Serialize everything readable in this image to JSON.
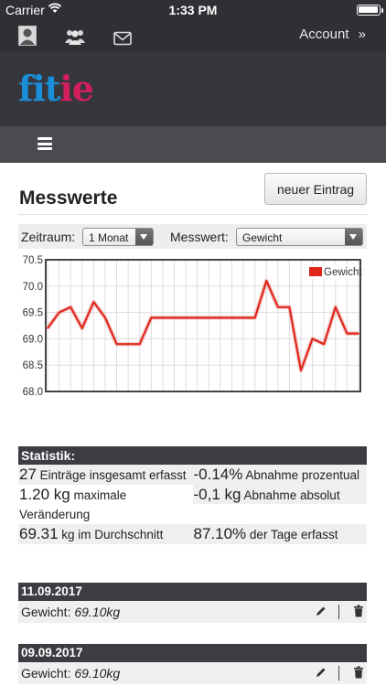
{
  "status_bar": {
    "carrier": "Carrier",
    "time": "1:33 PM"
  },
  "top_bar": {
    "icons": [
      "user-icon",
      "group-icon",
      "mail-icon"
    ],
    "account_label": "Account",
    "account_chevron": "»"
  },
  "brand": {
    "logo_part1": "fit",
    "logo_part2": "ie",
    "colors": {
      "blue": "#1a8ed8",
      "red": "#d01f5b"
    }
  },
  "nav": {
    "menu_icon": "hamburger-icon"
  },
  "page": {
    "title": "Messwerte",
    "new_entry_button": "neuer Eintrag"
  },
  "filter": {
    "period_label": "Zeitraum:",
    "period_value": "1 Monat",
    "measure_label": "Messwert:",
    "measure_value": "Gewicht"
  },
  "chart_data": {
    "type": "line",
    "series": [
      {
        "name": "Gewicht",
        "color": "#e0261b",
        "values": [
          69.2,
          69.5,
          69.6,
          69.2,
          69.7,
          69.4,
          68.9,
          68.9,
          68.9,
          69.4,
          69.4,
          69.4,
          69.4,
          69.4,
          69.4,
          69.4,
          69.4,
          69.4,
          69.4,
          70.1,
          69.6,
          69.6,
          68.4,
          69.0,
          68.9,
          69.6,
          69.1,
          69.1
        ]
      }
    ],
    "ylim": [
      68.0,
      70.5
    ],
    "yticks": [
      "70.5",
      "70.0",
      "69.5",
      "69.0",
      "68.5",
      "68.0"
    ],
    "grid": true,
    "legend": "top-right"
  },
  "stats": {
    "header": "Statistik:",
    "rows": [
      [
        {
          "big": "27",
          "text": " Einträge insgesamt erfasst"
        },
        {
          "big": "-0.14%",
          "text": " Abnahme prozentual"
        }
      ],
      [
        {
          "big": "1.20 kg",
          "text": " maximale Veränderung"
        },
        {
          "big": "-0,1 kg",
          "text": " Abnahme absolut"
        }
      ],
      [
        {
          "big": "69.31",
          "text": " kg im Durchschnitt"
        },
        {
          "big": "87.10%",
          "text": " der Tage erfasst"
        }
      ]
    ]
  },
  "entries": [
    {
      "date": "11.09.2017",
      "label": "Gewicht: ",
      "value": "69.10kg"
    },
    {
      "date": "09.09.2017",
      "label": "Gewicht: ",
      "value": "69.10kg"
    }
  ]
}
